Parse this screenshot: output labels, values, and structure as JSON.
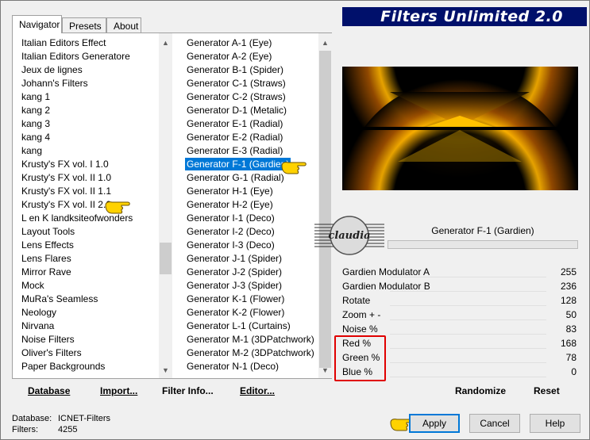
{
  "app": {
    "title": "Filters Unlimited 2.0"
  },
  "tabs": [
    {
      "label": "Navigator",
      "active": true
    },
    {
      "label": "Presets",
      "active": false
    },
    {
      "label": "About",
      "active": false
    }
  ],
  "categories": {
    "items": [
      "Italian Editors Effect",
      "Italian Editors Generatore",
      "Jeux de lignes",
      "Johann's Filters",
      "kang 1",
      "kang 2",
      "kang 3",
      "kang 4",
      "kang",
      "Krusty's FX vol. I 1.0",
      "Krusty's FX vol. II 1.0",
      "Krusty's FX vol. II 1.1",
      "Krusty's FX vol. II 2.0",
      "L en K landksiteofwonders",
      "Layout Tools",
      "Lens Effects",
      "Lens Flares",
      "Mirror Rave",
      "Mock",
      "MuRa's Seamless",
      "Neology",
      "Nirvana",
      "Noise Filters",
      "Oliver's Filters",
      "Paper Backgrounds"
    ],
    "highlighted": "Krusty's FX vol. II 2.0"
  },
  "filters": {
    "items": [
      "Generator A-1 (Eye)",
      "Generator A-2 (Eye)",
      "Generator B-1 (Spider)",
      "Generator C-1 (Straws)",
      "Generator C-2 (Straws)",
      "Generator D-1 (Metalic)",
      "Generator E-1 (Radial)",
      "Generator E-2 (Radial)",
      "Generator E-3 (Radial)",
      "Generator F-1 (Gardien)",
      "Generator G-1 (Radial)",
      "Generator H-1 (Eye)",
      "Generator H-2 (Eye)",
      "Generator I-1 (Deco)",
      "Generator I-2 (Deco)",
      "Generator I-3 (Deco)",
      "Generator J-1 (Spider)",
      "Generator J-2 (Spider)",
      "Generator J-3 (Spider)",
      "Generator K-1 (Flower)",
      "Generator K-2 (Flower)",
      "Generator L-1 (Curtains)",
      "Generator M-1 (3DPatchwork)",
      "Generator M-2 (3DPatchwork)",
      "Generator N-1 (Deco)"
    ],
    "selected": "Generator F-1 (Gardien)"
  },
  "preview": {
    "filter_name": "Generator F-1 (Gardien)",
    "watermark_text": "claudia"
  },
  "parameters": [
    {
      "label": "Gardien Modulator A",
      "value": "255"
    },
    {
      "label": "Gardien Modulator B",
      "value": "236"
    },
    {
      "label": "Rotate",
      "value": "128"
    },
    {
      "label": "Zoom + -",
      "value": "50"
    },
    {
      "label": "Noise %",
      "value": "83"
    },
    {
      "label": "Red %",
      "value": "168"
    },
    {
      "label": "Green %",
      "value": "78"
    },
    {
      "label": "Blue %",
      "value": "0"
    }
  ],
  "buttons": {
    "database": "Database",
    "import": "Import...",
    "filter_info": "Filter Info...",
    "editor": "Editor...",
    "randomize": "Randomize",
    "reset": "Reset",
    "apply": "Apply",
    "cancel": "Cancel",
    "help": "Help"
  },
  "status": {
    "database_label": "Database:",
    "database_value": "ICNET-Filters",
    "filters_label": "Filters:",
    "filters_value": "4255"
  },
  "colors": {
    "banner_bg": "#00106b",
    "selection": "#0078d7",
    "annotation_red": "#e00000",
    "hand_yellow": "#ffd200"
  }
}
